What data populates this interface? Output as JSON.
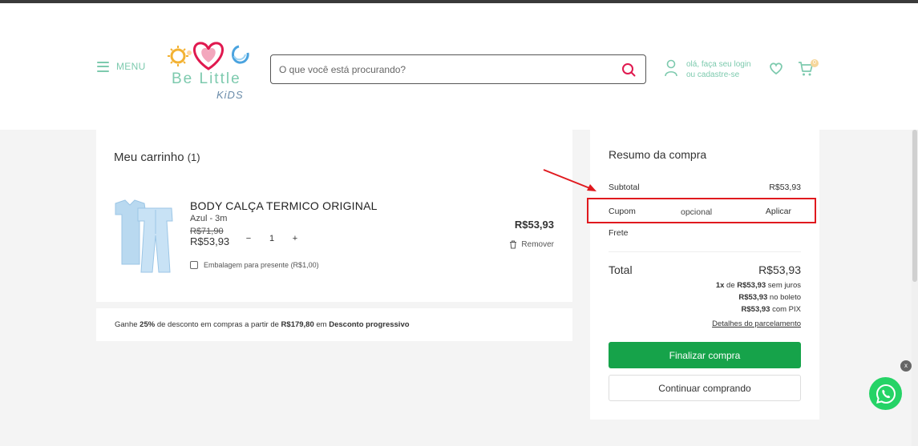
{
  "header": {
    "menu_label": "MENU",
    "logo_text_main": "Be Little",
    "logo_text_sub": "KiDS",
    "search_placeholder": "O que você está procurando?",
    "user_line1": "olá, faça seu login",
    "user_line2": "ou cadastre-se",
    "cart_count": "0"
  },
  "cart": {
    "title": "Meu carrinho",
    "count": "(1)",
    "item": {
      "name": "BODY CALÇA TERMICO ORIGINAL",
      "variant": "Azul - 3m",
      "old_price": "R$71,90",
      "price": "R$53,93",
      "quantity": "1",
      "line_total": "R$53,93",
      "remove_label": "Remover",
      "gift_label": "Embalagem para presente (R$1,00)"
    },
    "qty_minus": "−",
    "qty_plus": "+"
  },
  "promo": {
    "text_1": "Ganhe ",
    "percent": "25%",
    "text_2": " de desconto em compras a partir de ",
    "threshold": "R$179,80",
    "text_3": " em ",
    "program": "Desconto progressivo"
  },
  "summary": {
    "title": "Resumo da compra",
    "subtotal_label": "Subtotal",
    "subtotal_value": "R$53,93",
    "coupon_label": "Cupom",
    "coupon_placeholder": "opcional",
    "coupon_apply": "Aplicar",
    "shipping_label": "Frete",
    "total_label": "Total",
    "total_value": "R$53,93",
    "installment_count": "1x",
    "installment_de": " de ",
    "installment_value": "R$53,93",
    "installment_suffix": " sem juros",
    "boleto_value": "R$53,93",
    "boleto_suffix": " no boleto",
    "pix_value": "R$53,93",
    "pix_suffix": " com PIX",
    "details_link": "Detalhes do parcelamento",
    "finalize_button": "Finalizar compra",
    "continue_button": "Continuar comprando"
  },
  "whatsapp": {
    "close_label": "x"
  },
  "colors": {
    "brand_green": "#7dcaae",
    "primary_button": "#16a34a",
    "highlight": "#e0191e",
    "search_icon": "#e0194f"
  }
}
